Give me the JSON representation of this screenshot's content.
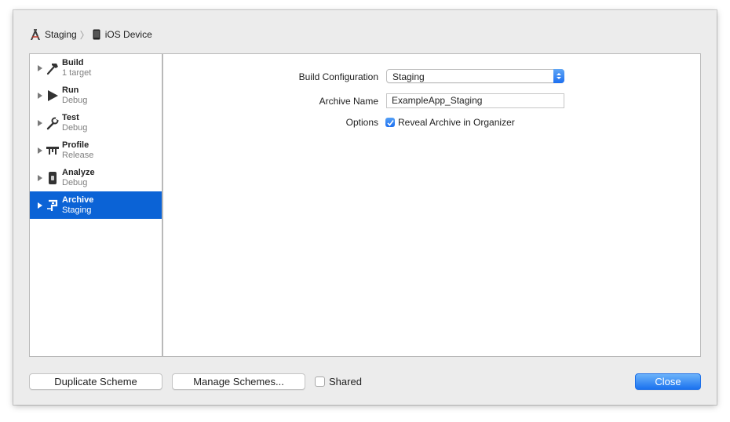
{
  "breadcrumb": {
    "scheme": "Staging",
    "scheme_icon": "hammer-app-icon",
    "destination": "iOS Device",
    "destination_icon": "iphone-icon"
  },
  "actions": [
    {
      "title": "Build",
      "subtitle": "1 target",
      "icon": "hammer-icon"
    },
    {
      "title": "Run",
      "subtitle": "Debug",
      "icon": "play-icon"
    },
    {
      "title": "Test",
      "subtitle": "Debug",
      "icon": "wrench-icon"
    },
    {
      "title": "Profile",
      "subtitle": "Release",
      "icon": "caliper-icon"
    },
    {
      "title": "Analyze",
      "subtitle": "Debug",
      "icon": "analyze-icon"
    },
    {
      "title": "Archive",
      "subtitle": "Staging",
      "icon": "archive-icon",
      "selected": true
    }
  ],
  "form": {
    "build_configuration_label": "Build Configuration",
    "build_configuration_value": "Staging",
    "archive_name_label": "Archive Name",
    "archive_name_value": "ExampleApp_Staging",
    "options_label": "Options",
    "reveal_archive_label": "Reveal Archive in Organizer",
    "reveal_archive_checked": true
  },
  "footer": {
    "duplicate_label": "Duplicate Scheme",
    "manage_label": "Manage Schemes...",
    "shared_label": "Shared",
    "shared_checked": false,
    "close_label": "Close"
  },
  "colors": {
    "selection": "#0b63d6",
    "accent": "#1c6ff0"
  }
}
